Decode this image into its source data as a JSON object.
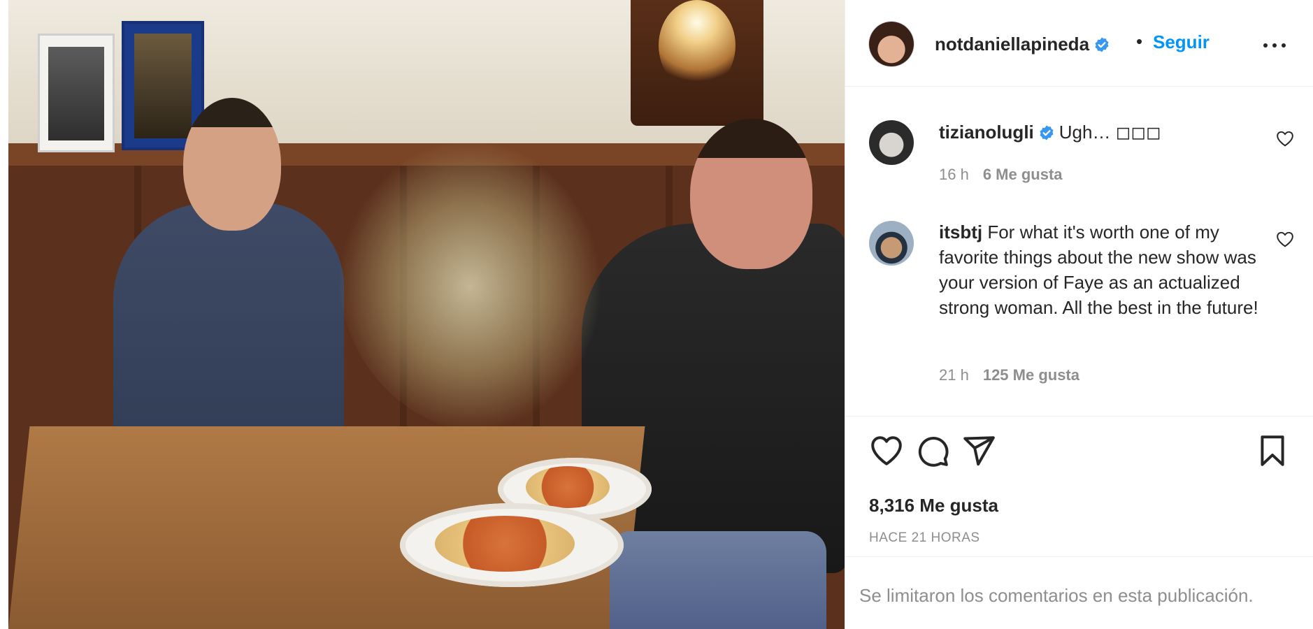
{
  "post": {
    "owner": {
      "username": "notdaniellapineda",
      "verified": true
    },
    "follow_label": "Seguir",
    "separator": "•",
    "likes_text": "8,316 Me gusta",
    "time_ago": "HACE 21 HORAS",
    "comments_limited_text": "Se limitaron los comentarios en esta publicación."
  },
  "comments": [
    {
      "username": "tizianolugli",
      "verified": true,
      "text": "Ugh… ◻◻◻",
      "time": "16 h",
      "likes": "6 Me gusta"
    },
    {
      "username": "itsbtj",
      "verified": false,
      "text": "For what it's worth one of my favorite things about the new show was your version of Faye as an actualized strong woman. All the best in the future!",
      "time": "21 h",
      "likes": "125 Me gusta"
    }
  ],
  "icons": {
    "more": "more-options-icon",
    "like": "heart-icon",
    "comment": "comment-bubble-icon",
    "share": "paper-plane-icon",
    "save": "bookmark-icon",
    "verified": "verified-badge-icon"
  },
  "colors": {
    "accent": "#0095f6",
    "verified": "#3897f0",
    "muted": "#8e8e8e",
    "text": "#262626"
  }
}
